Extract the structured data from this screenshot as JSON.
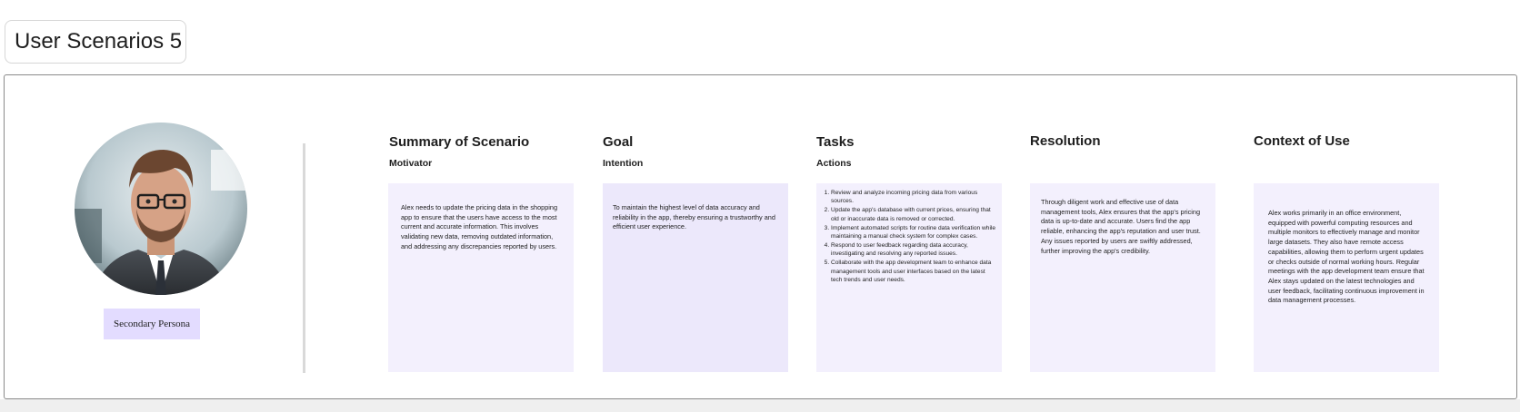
{
  "page": {
    "title": "User Scenarios 5"
  },
  "persona": {
    "label": "Secondary Persona"
  },
  "columns": [
    {
      "title": "Summary of Scenario",
      "subtitle": "Motivator",
      "body": "Alex needs to update the pricing data in the shopping app to ensure that the users have access to the most current and accurate information. This involves validating new data, removing outdated information, and addressing any discrepancies reported by users."
    },
    {
      "title": "Goal",
      "subtitle": "Intention",
      "body": "To maintain the highest level of data accuracy and reliability in the app, thereby ensuring a trustworthy and efficient user experience."
    },
    {
      "title": "Tasks",
      "subtitle": "Actions",
      "items": [
        "Review and analyze incoming pricing data from various sources.",
        "Update the app's database with current prices, ensuring that old or inaccurate data is removed or corrected.",
        "Implement automated scripts for routine data verification while maintaining a manual check system for complex cases.",
        "Respond to user feedback regarding data accuracy, investigating and resolving any reported issues.",
        "Collaborate with the app development team to enhance data management tools and user interfaces based on the latest tech trends and user needs."
      ]
    },
    {
      "title": "Resolution",
      "subtitle": "",
      "body": "Through diligent work and effective use of data management tools, Alex ensures that the app's pricing data is up-to-date and accurate. Users find the app reliable, enhancing the app's reputation and user trust. Any issues reported by users are swiftly addressed, further improving the app's credibility."
    },
    {
      "title": "Context of Use",
      "subtitle": "",
      "body": "Alex works primarily in an office environment, equipped with powerful computing resources and multiple monitors to effectively manage and monitor large datasets. They also have remote access capabilities, allowing them to perform urgent updates or checks outside of normal working hours. Regular meetings with the app development team ensure that Alex stays updated on the latest technologies and user feedback, facilitating continuous improvement in data management processes."
    }
  ]
}
